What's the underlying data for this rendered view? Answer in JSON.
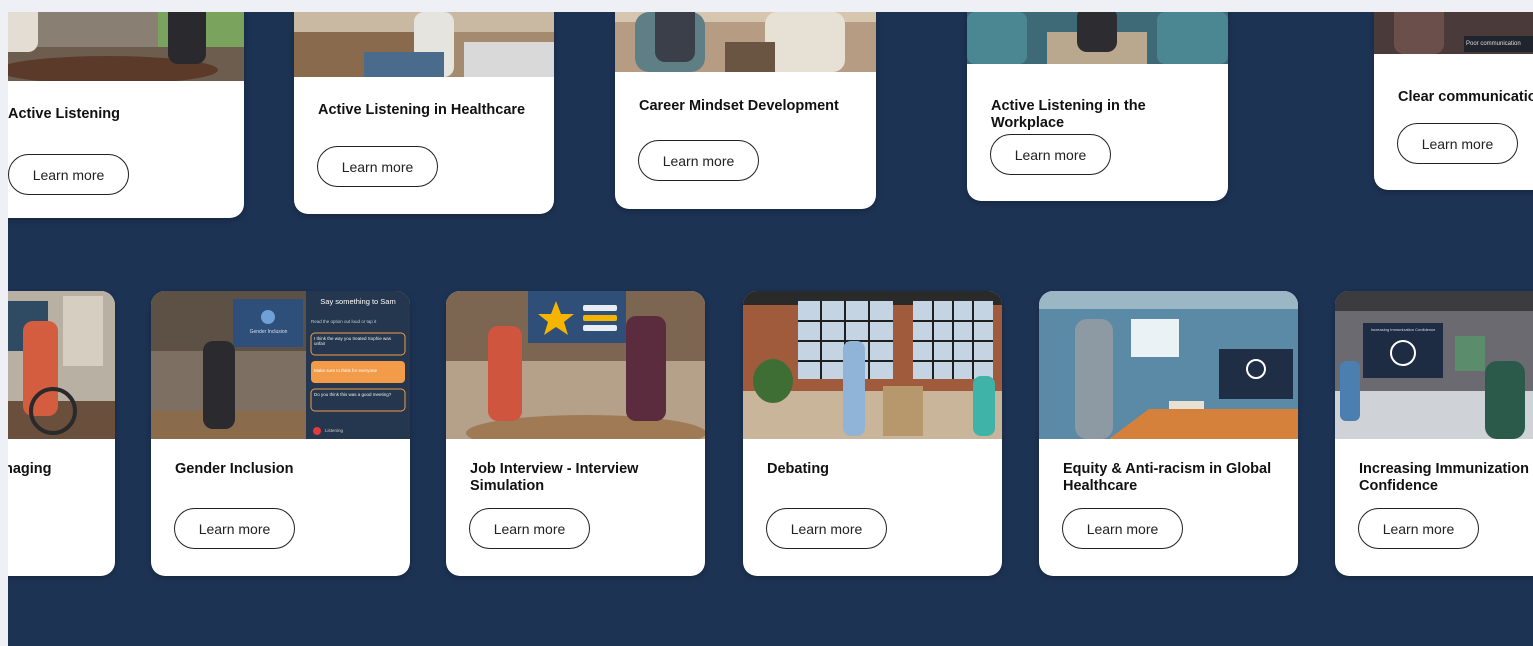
{
  "button_label": "Learn more",
  "top_row": [
    {
      "title": "Active Listening"
    },
    {
      "title": "Active Listening in Healthcare"
    },
    {
      "title": "Career Mindset Development"
    },
    {
      "title": "Active Listening in the Workplace"
    },
    {
      "title": "Clear communicatio"
    }
  ],
  "bottom_row": [
    {
      "title": "naging"
    },
    {
      "title": "Gender Inclusion",
      "chat": {
        "header": "Say something to Sam",
        "hint": "Read the option out loud or tap it",
        "option1": "I think the way you treated Sophie was unfair",
        "option2": "Make sure to think for everyone",
        "option3": "Do you think this was a good meeting?",
        "status": "Listening",
        "screen_label": "Gender Inclusion"
      }
    },
    {
      "title": "Job Interview - Interview Simulation"
    },
    {
      "title": "Debating"
    },
    {
      "title": "Equity & Anti-racism in Global Healthcare"
    },
    {
      "title": "Increasing Immunization Confidence",
      "screen_label": "Increasing Immunization Confidence"
    }
  ],
  "top_right_tag": "Poor communication",
  "colors": {
    "background": "#1d3354",
    "card": "#ffffff",
    "accent_star": "#f4b400",
    "chat_highlight": "#f29b48"
  }
}
